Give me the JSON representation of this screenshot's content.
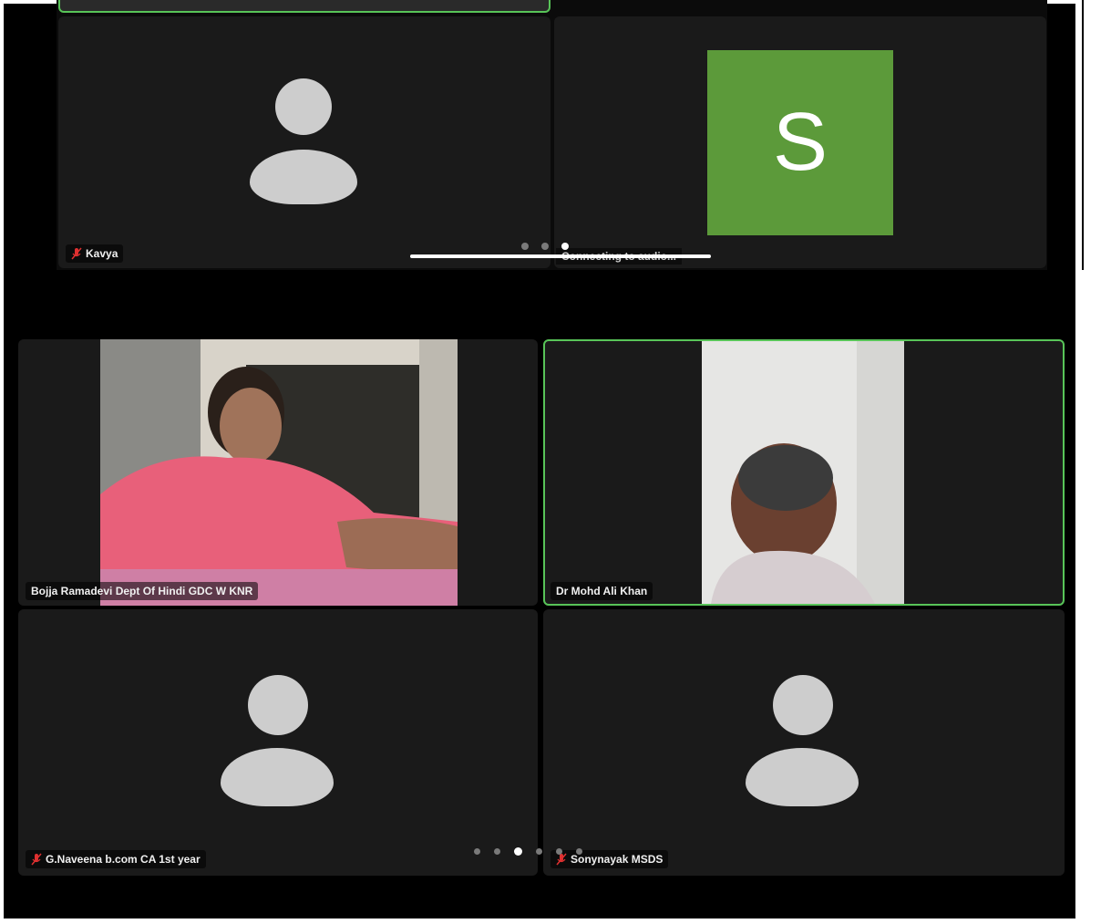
{
  "top_strip": {
    "participants": [
      {
        "name": "Kavya",
        "muted": true
      },
      {
        "initial": "S",
        "status": "Connecting to audio..."
      }
    ],
    "page_dots": 3,
    "active_dot": 2
  },
  "bottom_grid": {
    "participants": [
      {
        "name": "Bojja Ramadevi Dept Of Hindi GDC W KNR",
        "video": true
      },
      {
        "name": "Dr Mohd Ali Khan",
        "video": true,
        "speaking": true
      },
      {
        "name": "G.Naveena b.com CA 1st year",
        "muted": true
      },
      {
        "name": "Sonynayak MSDS",
        "muted": true
      }
    ],
    "page_dots": 6,
    "active_dot": 2
  },
  "colors": {
    "tile_bg": "#1a1a1a",
    "active_border": "#58c458",
    "avatar_initial_bg": "#5c9a3a",
    "muted_icon": "#e03030"
  }
}
